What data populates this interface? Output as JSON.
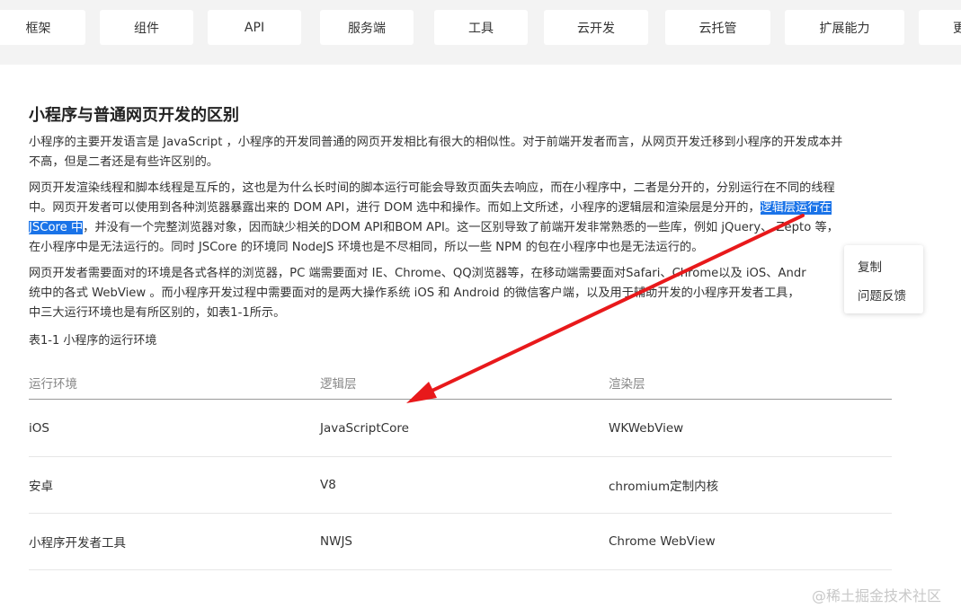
{
  "nav": {
    "items": [
      "框架",
      "组件",
      "API",
      "服务端",
      "工具",
      "云开发",
      "云托管",
      "扩展能力",
      "更"
    ]
  },
  "article": {
    "title": "小程序与普通网页开发的区别",
    "p1_lines": [
      "小程序的主要开发语言是 JavaScript ，小程序的开发同普通的网页开发相比有很大的相似性。对于前端开发者而言，从网页开发迁移到小程序的开发成本并",
      "不高，但是二者还是有些许区别的。"
    ],
    "p2": {
      "line1": "网页开发渲染线程和脚本线程是互斥的，这也是为什么长时间的脚本运行可能会导致页面失去响应，而在小程序中，二者是分开的，分别运行在不同的线程",
      "line2_pre": "中。网页开发者可以使用到各种浏览器暴露出来的 DOM API，进行 DOM 选中和操作。而如上文所述，小程序的逻辑层和渲染层是分开的，",
      "line2_hl": "逻辑层运行在",
      "line3_hl": "JSCore 中",
      "line3_post": "，并没有一个完整浏览器对象，因而缺少相关的DOM API和BOM API。这一区别导致了前端开发非常熟悉的一些库，例如 jQuery、 Zepto 等，",
      "line4": "在小程序中是无法运行的。同时 JSCore 的环境同 NodeJS 环境也是不尽相同，所以一些 NPM 的包在小程序中也是无法运行的。"
    },
    "p3_lines": [
      "网页开发者需要面对的环境是各式各样的浏览器，PC 端需要面对 IE、Chrome、QQ浏览器等，在移动端需要面对Safari、Chrome以及 iOS、Andr",
      "统中的各式 WebView 。而小程序开发过程中需要面对的是两大操作系统 iOS 和 Android 的微信客户端，以及用于辅助开发的小程序开发者工具，",
      "中三大运行环境也是有所区别的，如表1-1所示。"
    ],
    "caption": "表1-1 小程序的运行环境"
  },
  "table": {
    "headers": [
      "运行环境",
      "逻辑层",
      "渲染层"
    ],
    "rows": [
      [
        "iOS",
        "JavaScriptCore",
        "WKWebView"
      ],
      [
        "安卓",
        "V8",
        "chromium定制内核"
      ],
      [
        "小程序开发者工具",
        "NWJS",
        "Chrome WebView"
      ]
    ]
  },
  "context_menu": {
    "items": [
      "复制",
      "问题反馈"
    ]
  },
  "watermark": "@稀土掘金技术社区",
  "colors": {
    "highlight": "#1a73e8",
    "arrow": "#e8191b",
    "nav_bg": "#f3f3f3"
  }
}
